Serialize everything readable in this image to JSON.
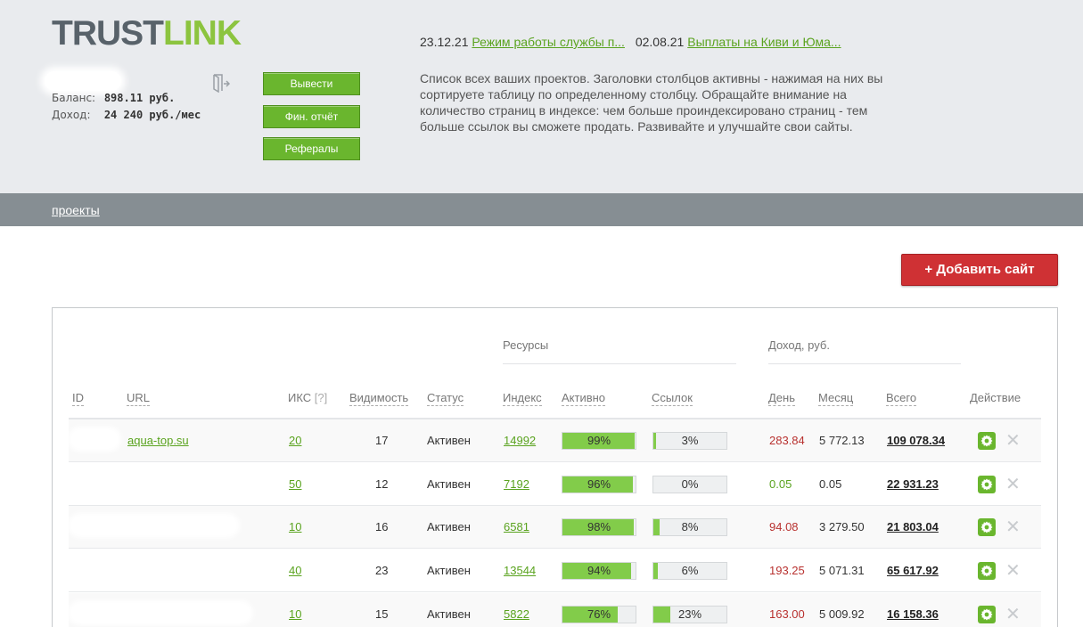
{
  "logo": {
    "part1": "TRUST",
    "part2": "LINK"
  },
  "account": {
    "balance_label": "Баланс:",
    "balance_value": "898.11  руб.",
    "income_label": "Доход:",
    "income_value": "24 240 руб./мес"
  },
  "buttons": {
    "withdraw": "Вывести",
    "fin_report": "Фин. отчёт",
    "referrals": "Рефералы"
  },
  "news": [
    {
      "date": "23.12.21",
      "title": "Режим работы службы п..."
    },
    {
      "date": "02.08.21",
      "title": "Выплаты на Киви и Юма..."
    }
  ],
  "description": "Список всех ваших проектов. Заголовки столбцов активны - нажимая на них вы сортируете таблицу по определенному столбцу. Обращайте внимание на количество страниц в индексе: чем больше проиндексировано страниц - тем больше ссылок вы сможете продать. Развивайте и улучшайте свои сайты.",
  "breadcrumb": "проекты",
  "add_site_button": "+ Добавить сайт",
  "table": {
    "groups": {
      "resources": "Ресурсы",
      "income": "Доход,  руб."
    },
    "columns": {
      "id": "ID",
      "url": "URL",
      "iks": "ИКС",
      "iks_help": "[?]",
      "visibility": "Видимость",
      "status": "Статус",
      "index": "Индекс",
      "active": "Активно",
      "links": "Ссылок",
      "day": "День",
      "month": "Месяц",
      "total": "Всего",
      "action": "Действие"
    },
    "rows": [
      {
        "url": "aqua-top.su",
        "iks": "20",
        "visibility": "17",
        "status": "Активен",
        "index": "14992",
        "active_pct": 99,
        "active_label": "99%",
        "links_pct": 3,
        "links_label": "3%",
        "day": "283.84",
        "day_color": "red",
        "month": "5 772.13",
        "total": "109 078.34"
      },
      {
        "url": "",
        "iks": "50",
        "visibility": "12",
        "status": "Активен",
        "index": "7192",
        "active_pct": 96,
        "active_label": "96%",
        "links_pct": 0,
        "links_label": "0%",
        "day": "0.05",
        "day_color": "green",
        "month": "0.05",
        "total": "22 931.23"
      },
      {
        "url": "",
        "iks": "10",
        "visibility": "16",
        "status": "Активен",
        "index": "6581",
        "active_pct": 98,
        "active_label": "98%",
        "links_pct": 8,
        "links_label": "8%",
        "day": "94.08",
        "day_color": "red",
        "month": "3 279.50",
        "total": "21 803.04"
      },
      {
        "url": "",
        "iks": "40",
        "visibility": "23",
        "status": "Активен",
        "index": "13544",
        "active_pct": 94,
        "active_label": "94%",
        "links_pct": 6,
        "links_label": "6%",
        "day": "193.25",
        "day_color": "red",
        "month": "5 071.31",
        "total": "65 617.92"
      },
      {
        "url": "",
        "iks": "10",
        "visibility": "15",
        "status": "Активен",
        "index": "5822",
        "active_pct": 76,
        "active_label": "76%",
        "links_pct": 23,
        "links_label": "23%",
        "day": "163.00",
        "day_color": "red",
        "month": "5 009.92",
        "total": "16 158.36"
      }
    ]
  },
  "colors": {
    "accent_green": "#6ab62e",
    "link_green": "#5aa31f",
    "add_red": "#cf3134",
    "nav_gray": "#868e93",
    "income_red": "#b8312f"
  },
  "icons": {
    "logout": "door-icon",
    "settings": "gear-icon",
    "delete": "close-icon"
  }
}
